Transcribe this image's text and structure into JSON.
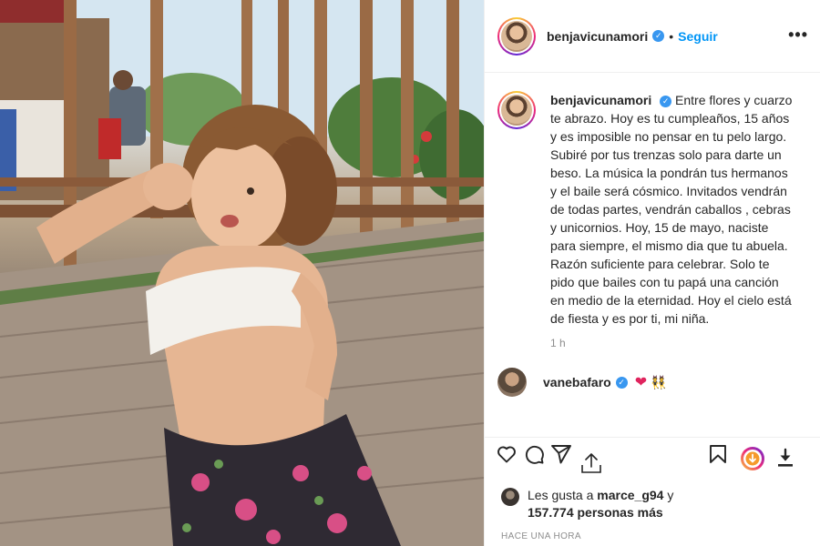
{
  "post": {
    "username": "benjavicunamori",
    "follow_label": "Seguir",
    "separator": "•",
    "more_label": "•••",
    "verified_mark": "✓"
  },
  "caption": {
    "username": "benjavicunamori",
    "text": "Entre flores y cuarzo te abrazo. Hoy es tu cumpleaños, 15 años y es imposible no pensar en tu pelo largo. Subiré por tus trenzas solo para darte un beso. La música la pondrán tus hermanos y el baile será cósmico. Invitados vendrán de todas partes, vendrán caballos , cebras y unicornios. Hoy, 15 de mayo, naciste para siempre, el mismo dia que tu abuela. Razón suficiente para celebrar. Solo te pido que bailes con tu papá una canción en medio de la eternidad. Hoy el cielo está de fiesta y es por ti, mi niña.",
    "time_ago": "1 h"
  },
  "comment": {
    "username": "vanebafaro",
    "emoji_heart": "❤",
    "emoji_dance": "👯"
  },
  "likes": {
    "prefix": "Les gusta a",
    "user": "marce_g94",
    "connector": "y",
    "count": "157.774 personas más"
  },
  "timestamp": "HACE UNA HORA",
  "icons": {
    "like": "heart-outline-icon",
    "comment": "comment-bubble-icon",
    "share": "paper-plane-icon",
    "save": "bookmark-icon",
    "story": "instagram-story-icon",
    "download": "download-icon",
    "upload": "upload-icon"
  },
  "colors": {
    "link_blue": "#0095f6",
    "verified_blue": "#3897f0",
    "text_primary": "#262626",
    "text_secondary": "#8e8e8e",
    "divider": "#efefef"
  }
}
